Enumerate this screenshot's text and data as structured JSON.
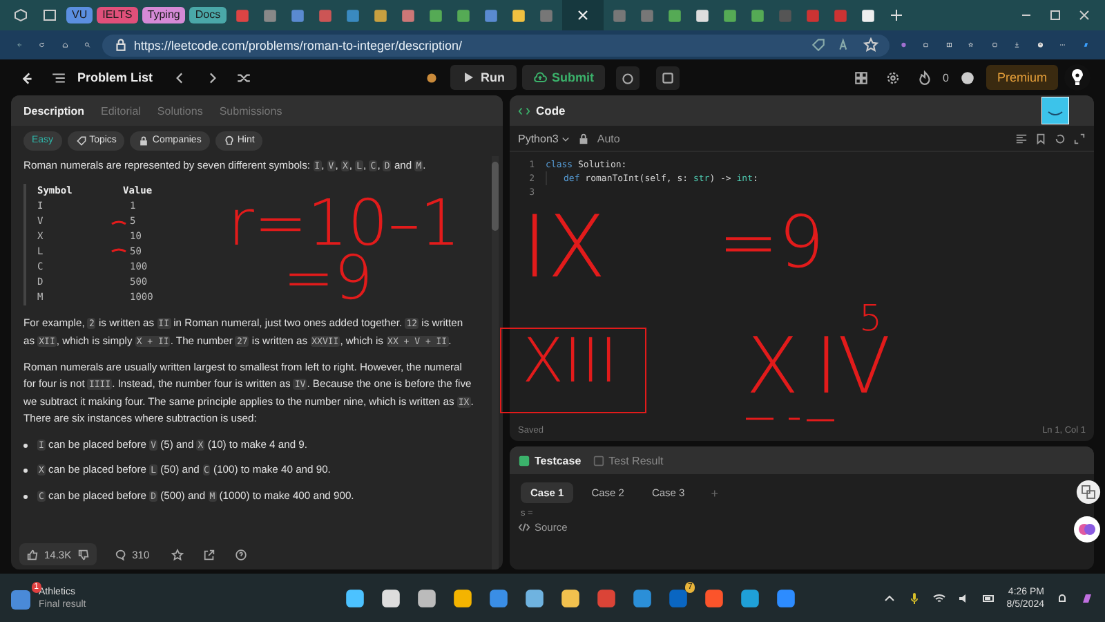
{
  "browser": {
    "tab_groups": [
      {
        "label": "VU",
        "color": "#5b8fe0"
      },
      {
        "label": "IELTS",
        "color": "#e0507a"
      },
      {
        "label": "Typing",
        "color": "#d58ad6"
      },
      {
        "label": "Docs",
        "color": "#4aa8a8"
      }
    ],
    "url": "https://leetcode.com/problems/roman-to-integer/description/"
  },
  "nav": {
    "title": "Problem List",
    "run": "Run",
    "submit": "Submit",
    "streak": "0",
    "premium": "Premium"
  },
  "description": {
    "tabs": [
      {
        "label": "Description",
        "selected": true
      },
      {
        "label": "Editorial",
        "selected": false
      },
      {
        "label": "Solutions",
        "selected": false
      },
      {
        "label": "Submissions",
        "selected": false
      }
    ],
    "tags": [
      {
        "label": "Easy",
        "kind": "difficulty"
      },
      {
        "label": "Topics",
        "kind": "tag"
      },
      {
        "label": "Companies",
        "kind": "lock"
      },
      {
        "label": "Hint",
        "kind": "bulb"
      }
    ],
    "intro": [
      {
        "t": "Roman numerals are represented by seven different symbols: ",
        "code": false
      },
      {
        "t": "I",
        "code": true
      },
      {
        "t": ", ",
        "code": false
      },
      {
        "t": "V",
        "code": true
      },
      {
        "t": ", ",
        "code": false
      },
      {
        "t": "X",
        "code": true
      },
      {
        "t": ", ",
        "code": false
      },
      {
        "t": "L",
        "code": true
      },
      {
        "t": ", ",
        "code": false
      },
      {
        "t": "C",
        "code": true
      },
      {
        "t": ", ",
        "code": false
      },
      {
        "t": "D",
        "code": true
      },
      {
        "t": " and ",
        "code": false
      },
      {
        "t": "M",
        "code": true
      },
      {
        "t": ".",
        "code": false
      }
    ],
    "table": {
      "columns": [
        "Symbol",
        "Value"
      ],
      "rows": [
        [
          "I",
          "1"
        ],
        [
          "V",
          "5"
        ],
        [
          "X",
          "10"
        ],
        [
          "L",
          "50"
        ],
        [
          "C",
          "100"
        ],
        [
          "D",
          "500"
        ],
        [
          "M",
          "1000"
        ]
      ]
    },
    "paragraphs": [
      [
        {
          "t": "For example, ",
          "code": false
        },
        {
          "t": "2",
          "code": true
        },
        {
          "t": " is written as ",
          "code": false
        },
        {
          "t": "II",
          "code": true
        },
        {
          "t": " in Roman numeral, just two ones added together. ",
          "code": false
        },
        {
          "t": "12",
          "code": true
        },
        {
          "t": " is written as ",
          "code": false
        },
        {
          "t": "XII",
          "code": true
        },
        {
          "t": ", which is simply ",
          "code": false
        },
        {
          "t": "X + II",
          "code": true
        },
        {
          "t": ". The number ",
          "code": false
        },
        {
          "t": "27",
          "code": true
        },
        {
          "t": " is written as ",
          "code": false
        },
        {
          "t": "XXVII",
          "code": true
        },
        {
          "t": ", which is ",
          "code": false
        },
        {
          "t": "XX + V + II",
          "code": true
        },
        {
          "t": ".",
          "code": false
        }
      ],
      [
        {
          "t": "Roman numerals are usually written largest to smallest from left to right. However, the numeral for four is not ",
          "code": false
        },
        {
          "t": "IIII",
          "code": true
        },
        {
          "t": ". Instead, the number four is written as ",
          "code": false
        },
        {
          "t": "IV",
          "code": true
        },
        {
          "t": ". Because the one is before the five we subtract it making four. The same principle applies to the number nine, which is written as ",
          "code": false
        },
        {
          "t": "IX",
          "code": true
        },
        {
          "t": ". There are six instances where subtraction is used:",
          "code": false
        }
      ]
    ],
    "bullets": [
      [
        {
          "t": "I",
          "code": true
        },
        {
          "t": " can be placed before ",
          "code": false
        },
        {
          "t": "V",
          "code": true
        },
        {
          "t": " (5) and ",
          "code": false
        },
        {
          "t": "X",
          "code": true
        },
        {
          "t": " (10) to make 4 and 9.",
          "code": false
        }
      ],
      [
        {
          "t": "X",
          "code": true
        },
        {
          "t": " can be placed before ",
          "code": false
        },
        {
          "t": "L",
          "code": true
        },
        {
          "t": " (50) and ",
          "code": false
        },
        {
          "t": "C",
          "code": true
        },
        {
          "t": " (100) to make 40 and 90.",
          "code": false
        }
      ],
      [
        {
          "t": "C",
          "code": true
        },
        {
          "t": " can be placed before ",
          "code": false
        },
        {
          "t": "D",
          "code": true
        },
        {
          "t": " (500) and ",
          "code": false
        },
        {
          "t": "M",
          "code": true
        },
        {
          "t": " (1000) to make 400 and 900.",
          "code": false
        }
      ]
    ],
    "likes": "14.3K",
    "comments": "310"
  },
  "code": {
    "title": "Code",
    "language": "Python3",
    "mode": "Auto",
    "lines": [
      {
        "num": "1",
        "tokens": [
          {
            "kind": "kw",
            "t": "class"
          },
          {
            "kind": "plain",
            "t": " Solution:"
          }
        ]
      },
      {
        "num": "2",
        "tokens": [
          {
            "kind": "kw",
            "t": "def"
          },
          {
            "kind": "plain",
            "t": " romanToInt(self, s: "
          },
          {
            "kind": "type",
            "t": "str"
          },
          {
            "kind": "plain",
            "t": ") -> "
          },
          {
            "kind": "type",
            "t": "int"
          },
          {
            "kind": "plain",
            "t": ":"
          }
        ]
      },
      {
        "num": "3"
      }
    ],
    "status": "Saved",
    "cursor": "Ln 1, Col 1"
  },
  "testcase": {
    "tabs": [
      {
        "label": "Testcase",
        "selected": true
      },
      {
        "label": "Test Result",
        "selected": false
      }
    ],
    "cases": [
      {
        "label": "Case 1",
        "selected": true
      },
      {
        "label": "Case 2",
        "selected": false
      },
      {
        "label": "Case 3",
        "selected": false
      }
    ],
    "add": "+",
    "input_label": "s =",
    "source": "Source"
  },
  "ink": [
    "r=10–1",
    "=9",
    "IX",
    "=9",
    "XIII",
    "X",
    "IV",
    "5"
  ],
  "taskbar": {
    "notification": {
      "title": "Athletics",
      "subtitle": "Final result",
      "badge": "1"
    },
    "linkedin_badge": "7",
    "time": "4:26 PM",
    "date": "8/5/2024"
  }
}
